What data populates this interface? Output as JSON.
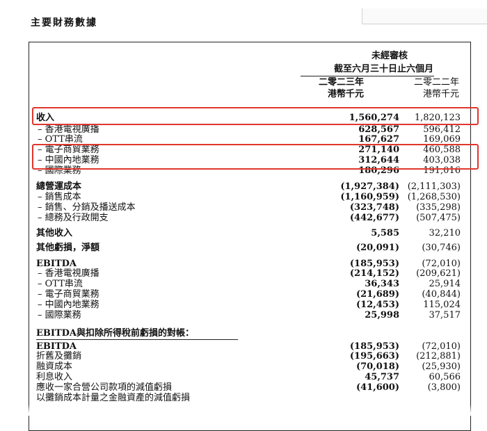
{
  "page_heading": "主要財務數據",
  "table": {
    "header": {
      "unaudited": "未經審核",
      "period": "截至六月三十日止六個月",
      "year_2023": "二零二三年",
      "year_2022": "二零二二年",
      "unit_2023": "港幣千元",
      "unit_2022": "港幣千元"
    },
    "rows": [
      {
        "label": "收入",
        "v2023": "1,560,274",
        "v2022": "1,820,123",
        "style": "bold"
      },
      {
        "label": "– 香港電視廣播",
        "v2023": "628,567",
        "v2022": "596,412",
        "style": "sub"
      },
      {
        "label": "– OTT串流",
        "v2023": "167,627",
        "v2022": "169,069",
        "style": "sub"
      },
      {
        "label": "– 電子商貿業務",
        "v2023": "271,140",
        "v2022": "460,588",
        "style": "sub"
      },
      {
        "label": "– 中國內地業務",
        "v2023": "312,644",
        "v2022": "403,038",
        "style": "sub"
      },
      {
        "label": "– 國際業務",
        "v2023": "180,296",
        "v2022": "191,016",
        "style": "sub"
      },
      {
        "label": "總營運成本",
        "v2023": "(1,927,384)",
        "v2022": "(2,111,303)",
        "style": "bold"
      },
      {
        "label": "– 銷售成本",
        "v2023": "(1,160,959)",
        "v2022": "(1,268,530)",
        "style": "sub"
      },
      {
        "label": "– 銷售、分銷及播送成本",
        "v2023": "(323,748)",
        "v2022": "(335,298)",
        "style": "sub"
      },
      {
        "label": "– 總務及行政開支",
        "v2023": "(442,677)",
        "v2022": "(507,475)",
        "style": "sub"
      },
      {
        "label": "其他收入",
        "v2023": "5,585",
        "v2022": "32,210",
        "style": "bold"
      },
      {
        "label": "其他虧損，淨額",
        "v2023": "(20,091)",
        "v2022": "(30,746)",
        "style": "bold"
      },
      {
        "label": "EBITDA",
        "v2023": "(185,953)",
        "v2022": "(72,010)",
        "style": "bold"
      },
      {
        "label": "– 香港電視廣播",
        "v2023": "(214,152)",
        "v2022": "(209,621)",
        "style": "sub"
      },
      {
        "label": "– OTT串流",
        "v2023": "36,343",
        "v2022": "25,914",
        "style": "sub"
      },
      {
        "label": "– 電子商貿業務",
        "v2023": "(21,689)",
        "v2022": "(40,844)",
        "style": "sub"
      },
      {
        "label": "– 中國內地業務",
        "v2023": "(12,453)",
        "v2022": "115,024",
        "style": "sub"
      },
      {
        "label": "– 國際業務",
        "v2023": "25,998",
        "v2022": "37,517",
        "style": "sub"
      }
    ],
    "reconciliation_heading": "EBITDA與扣除所得稅前虧損的對帳：",
    "reconciliation_rows": [
      {
        "label": "EBITDA",
        "v2023": "(185,953)",
        "v2022": "(72,010)",
        "style": "bold"
      },
      {
        "label": "折舊及攤銷",
        "v2023": "(195,663)",
        "v2022": "(212,881)",
        "style": "plain"
      },
      {
        "label": "融資成本",
        "v2023": "(70,018)",
        "v2022": "(25,930)",
        "style": "plain"
      },
      {
        "label": "利息收入",
        "v2023": "45,737",
        "v2022": "60,566",
        "style": "plain"
      },
      {
        "label": "應收一家合營公司款項的減值虧損",
        "v2023": "(41,600)",
        "v2022": "(3,800)",
        "style": "plain"
      },
      {
        "label": "以攤銷成本計量之金融資產的減值虧損",
        "v2023": "",
        "v2022": "",
        "style": "plain"
      }
    ]
  },
  "highlight_color": "#e0362c"
}
